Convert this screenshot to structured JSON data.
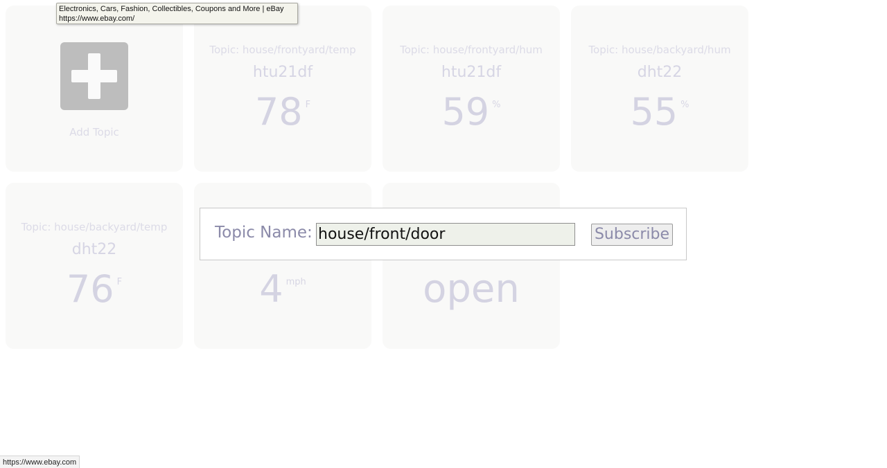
{
  "tooltip": {
    "title": "Electronics, Cars, Fashion, Collectibles, Coupons and More | eBay",
    "url": "https://www.ebay.com/"
  },
  "add_card": {
    "icon": "plus-icon",
    "label": "Add Topic"
  },
  "cards": [
    {
      "topic": "Topic: house/frontyard/temp",
      "sensor": "htu21df",
      "value": "78",
      "unit": "F"
    },
    {
      "topic": "Topic: house/frontyard/hum",
      "sensor": "htu21df",
      "value": "59",
      "unit": "%"
    },
    {
      "topic": "Topic: house/backyard/hum",
      "sensor": "dht22",
      "value": "55",
      "unit": "%"
    },
    {
      "topic": "Topic: house/backyard/temp",
      "sensor": "dht22",
      "value": "76",
      "unit": "F"
    },
    {
      "value": "4",
      "unit": "mph"
    },
    {
      "value": "open"
    }
  ],
  "dialog": {
    "label": "Topic Name:",
    "input_value": "house/front/door",
    "button_label": "Subscribe"
  },
  "status_bar": {
    "url": "https://www.ebay.com"
  }
}
